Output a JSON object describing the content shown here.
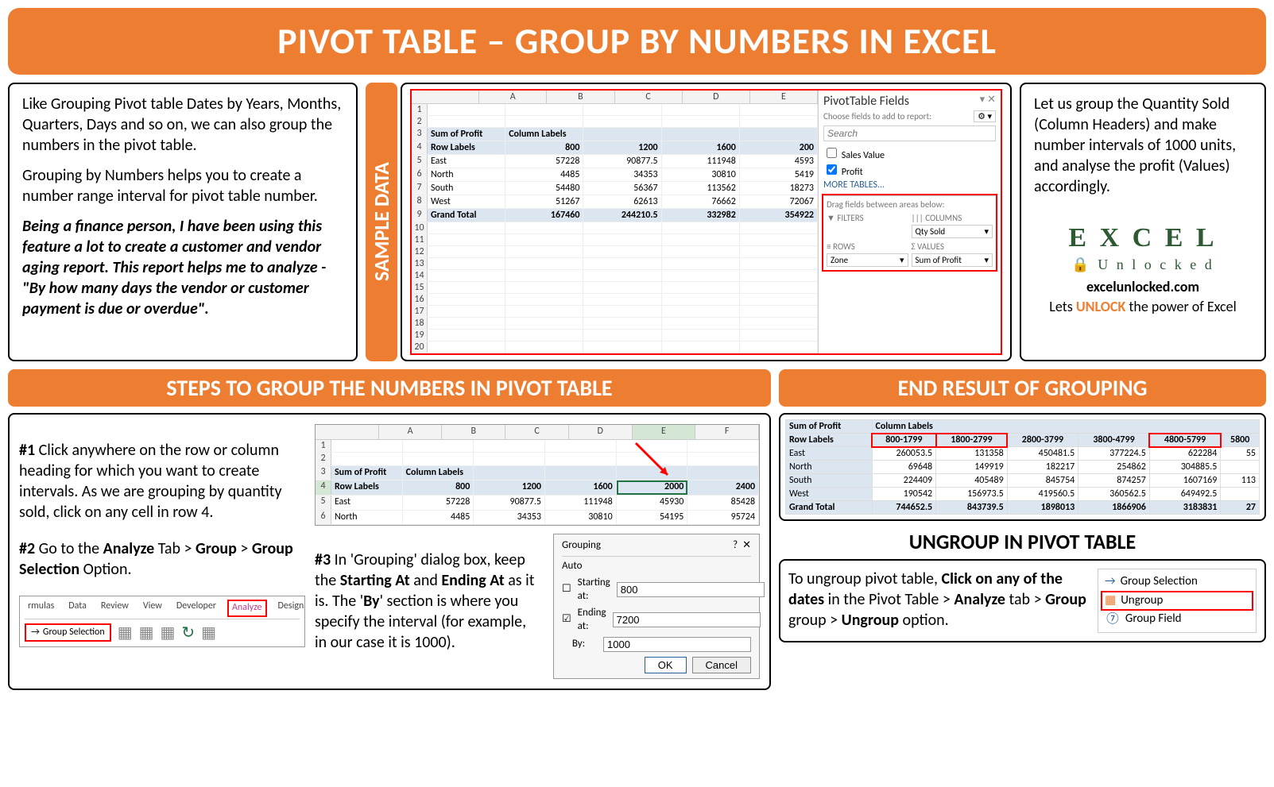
{
  "title": "PIVOT TABLE – GROUP BY NUMBERS IN EXCEL",
  "intro": {
    "p1": "Like Grouping Pivot table Dates by Years, Months, Quarters, Days and so on, we can also group the numbers in the pivot table.",
    "p2": "Grouping by Numbers helps you to create a number range interval for pivot table number.",
    "p3": "Being a finance person, I have been using this feature a lot to create a customer and vendor aging report. This report helps me to analyze - \"By how many days the vendor or customer payment is due or overdue\"."
  },
  "sample_label": "SAMPLE DATA",
  "sample_table": {
    "cols": [
      "A",
      "B",
      "C",
      "D",
      "E"
    ],
    "header_row": [
      "Sum of Profit",
      "Column Labels"
    ],
    "row_labels_row": [
      "Row Labels",
      "800",
      "1200",
      "1600",
      "200"
    ],
    "rows": [
      [
        "East",
        "57228",
        "90877.5",
        "111948",
        "4593"
      ],
      [
        "North",
        "4485",
        "34353",
        "30810",
        "5419"
      ],
      [
        "South",
        "54480",
        "56367",
        "113562",
        "18273"
      ],
      [
        "West",
        "51267",
        "62613",
        "76662",
        "72067"
      ]
    ],
    "grand_total": [
      "Grand Total",
      "167460",
      "244210.5",
      "332982",
      "354922"
    ]
  },
  "pt_fields": {
    "title": "PivotTable Fields",
    "sub": "Choose fields to add to report:",
    "search_placeholder": "Search",
    "chk_sales": "Sales Value",
    "chk_profit": "Profit",
    "more": "MORE TABLES...",
    "drag_label": "Drag fields between areas below:",
    "filters": "FILTERS",
    "columns": "COLUMNS",
    "columns_val": "Qty Sold",
    "rows": "ROWS",
    "rows_val": "Zone",
    "values": "VALUES",
    "values_val": "Sum of Profit"
  },
  "right_text": {
    "p1": "Let us group the Quantity Sold (Column Headers) and make number intervals of 1000 units, and analyse the profit (Values) accordingly.",
    "logo_top": "E X C E L",
    "logo_bottom": "U n l o c k e d",
    "site": "excelunlocked.com",
    "tag_prefix": "Lets ",
    "tag_word": "UNLOCK",
    "tag_suffix": " the power of Excel"
  },
  "steps_header": "STEPS TO GROUP THE NUMBERS IN PIVOT TABLE",
  "step1": {
    "num": "#1",
    "text": " Click anywhere on the row or column heading for which you want to create intervals. As we are grouping by quantity sold, click on any cell in row 4."
  },
  "step2": {
    "num": "#2",
    "text_a": " Go to the ",
    "analyze": "Analyze",
    "text_b": " Tab > ",
    "group": "Group",
    "text_c": " > ",
    "gs": "Group Selection",
    "text_d": " Option."
  },
  "step3": {
    "num": "#3",
    "text_a": " In 'Grouping' dialog box, keep the ",
    "starting": "Starting At",
    "text_b": " and ",
    "ending": "Ending At",
    "text_c": " as it is. The '",
    "by": "By",
    "text_d": "' section is where you specify the interval (for example, in our case it is 1000)."
  },
  "mini_table": {
    "cols": [
      "A",
      "B",
      "C",
      "D",
      "E",
      "F"
    ],
    "r3": [
      "Sum of Profit",
      "Column Labels",
      "",
      "",
      "",
      ""
    ],
    "r4": [
      "Row Labels",
      "800",
      "1200",
      "1600",
      "2000",
      "2400"
    ],
    "r5": [
      "East",
      "57228",
      "90877.5",
      "111948",
      "45930",
      "85428"
    ],
    "r6": [
      "North",
      "4485",
      "34353",
      "30810",
      "54195",
      "95724"
    ]
  },
  "ribbon": {
    "tabs": [
      "rmulas",
      "Data",
      "Review",
      "View",
      "Developer",
      "Analyze",
      "Design"
    ],
    "group_selection": "Group Selection"
  },
  "dialog": {
    "title": "Grouping",
    "auto": "Auto",
    "starting_label": "Starting at:",
    "starting_val": "800",
    "ending_label": "Ending at:",
    "ending_val": "7200",
    "by_label": "By:",
    "by_val": "1000",
    "ok": "OK",
    "cancel": "Cancel"
  },
  "result_header": "END RESULT OF GROUPING",
  "result_table": {
    "h1": "Sum of Profit",
    "h2": "Column Labels",
    "rowlbl": "Row Labels",
    "cols": [
      "800-1799",
      "1800-2799",
      "2800-3799",
      "3800-4799",
      "4800-5799",
      "5800"
    ],
    "rows": [
      [
        "East",
        "260053.5",
        "131358",
        "450481.5",
        "377224.5",
        "622284",
        "55"
      ],
      [
        "North",
        "69648",
        "149919",
        "182217",
        "254862",
        "304885.5",
        ""
      ],
      [
        "South",
        "224409",
        "405489",
        "845754",
        "874257",
        "1607169",
        "113"
      ],
      [
        "West",
        "190542",
        "156973.5",
        "419560.5",
        "360562.5",
        "649492.5",
        ""
      ]
    ],
    "grand_total": [
      "Grand Total",
      "744652.5",
      "843739.5",
      "1898013",
      "1866906",
      "3183831",
      "27"
    ]
  },
  "ungroup_header": "UNGROUP IN PIVOT TABLE",
  "ungroup": {
    "text_a": "To ungroup pivot table, ",
    "b1": "Click on any of the dates",
    "text_b": " in the Pivot Table > ",
    "b2": "Analyze",
    "text_c": " tab > ",
    "b3": "Group",
    "text_d": " group > ",
    "b4": "Ungroup",
    "text_e": " option.",
    "menu": {
      "gs": "Group Selection",
      "ug": "Ungroup",
      "gf": "Group Field"
    }
  }
}
